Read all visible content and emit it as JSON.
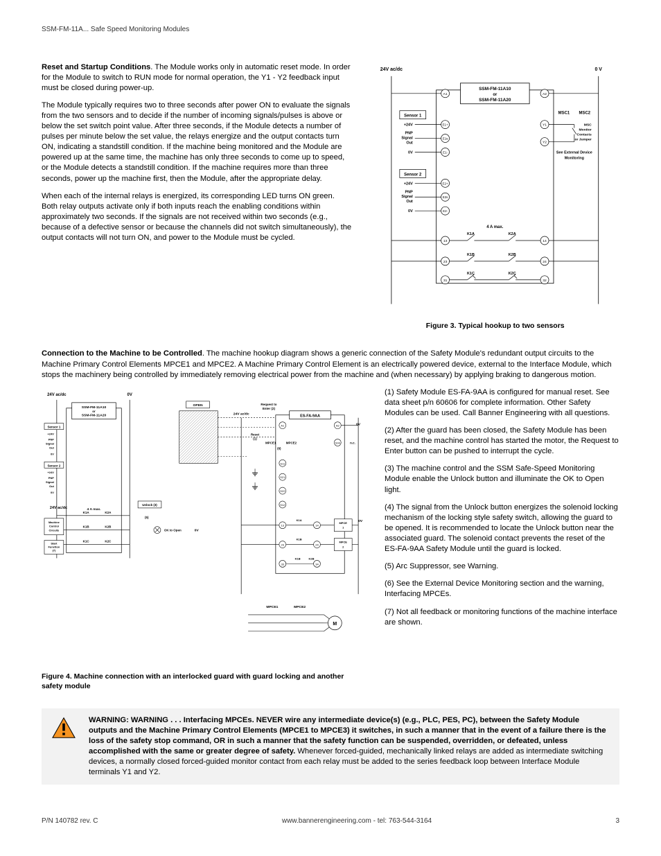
{
  "header": {
    "title": "SSM-FM-11A... Safe Speed Monitoring Modules"
  },
  "p1": {
    "lead": "Reset and Startup Conditions",
    "body": ". The Module works only in automatic reset mode. In order for the Module to switch to RUN mode for normal operation, the Y1 - Y2 feedback input must be closed during power-up."
  },
  "p2": "The Module typically requires two to three seconds after power ON to evaluate the signals from the two sensors and to decide if the number of incoming signals/pulses is above or below the set switch point value. After three seconds, if the Module detects a number of pulses per minute below the set value, the relays energize and the output contacts turn ON, indicating a standstill condition. If the machine being monitored and the Module are powered up at the same time, the machine has only three seconds to come up to speed, or the Module detects a standstill condition. If the machine requires more than three seconds, power up the machine first, then the Module, after the appropriate delay.",
  "p3": "When each of the internal relays is energized, its corresponding LED turns ON green. Both relay outputs activate only if both inputs reach the enabling conditions within approximately two seconds. If the signals are not received within two seconds (e.g., because of a defective sensor or because the channels did not switch simultaneously), the output contacts will not turn ON, and power to the Module must be cycled.",
  "fig3": {
    "caption": "Figure 3. Typical hookup to two sensors",
    "labels": {
      "v24": "24V ac/dc",
      "v0": "0 V",
      "model_a": "SSM-FM-11A10",
      "or": "or",
      "model_b": "SSM-FM-11A20",
      "s1": "Sensor 1",
      "s2": "Sensor 2",
      "p24": "+24V",
      "pnp": "PNP",
      "sig": "Signal",
      "out": "Out",
      "ov": "0V",
      "msc1": "MSC1",
      "msc2": "MSC2",
      "msc_note1": "MSC",
      "msc_note2": "Monitor",
      "msc_note3": "Contacts",
      "msc_note4": "or Jumper",
      "ext1": "See External Device",
      "ext2": "Monitoring",
      "amax": "4 A max.",
      "k1a": "K1A",
      "k2a": "K2A",
      "k1b": "K1B",
      "k2b": "K2B",
      "k1c": "K1C",
      "k2c": "K2C",
      "a1": "A1",
      "a2": "A2",
      "e1p": "E1+",
      "e1s": "E1s",
      "e1m": "E1-",
      "e2p": "E2+",
      "e2s": "E2s",
      "e2m": "E2-",
      "y1": "Y1",
      "y2": "Y2",
      "t13": "13",
      "t14": "14",
      "t23": "23",
      "t24": "24",
      "t31": "31",
      "t32": "32"
    }
  },
  "p4": {
    "lead": "Connection to the Machine to be Controlled",
    "body": ". The machine hookup diagram shows a generic connection of the Safety Module's redundant output circuits to the Machine Primary Control Elements MPCE1 and MPCE2. A Machine Primary Control Element is an electrically powered device, external to the Interface Module, which stops the machinery being controlled by immediately removing electrical power from the machine and (when necessary) by applying braking to dangerous motion."
  },
  "fig4": {
    "caption": "Figure 4. Machine connection with an interlocked guard with guard locking and another safety module",
    "labels": {
      "v24": "24V ac/dc",
      "v0": "0V",
      "open": "OPEN",
      "model_a": "SSM-FM-11A10",
      "or": "or",
      "model_b": "SSM-FM-11A20",
      "s1": "Sensor 1",
      "s2": "Sensor 2",
      "p24": "+24V",
      "pnp": "PNP",
      "sig": "Signal",
      "out": "Out",
      "ov": "0V",
      "req1": "Request to",
      "req2": "Enter (2)",
      "esfa": "ES-FA-9AA",
      "reset": "Reset",
      "reset_n": "(1)",
      "mpce1": "MPCE1",
      "mpce2": "MPCE2",
      "six": "(6)",
      "nc": "n.c.",
      "unlock": "Unlock (3)",
      "amax": "4 A max.",
      "five": "(5)",
      "mcc1": "Machine",
      "mcc2": "Control",
      "mcc3": "Circuits",
      "ok": "OK to Open",
      "start1": "Start",
      "start2": "Function",
      "start3": "(7)",
      "mpce_1": "MPCE",
      "one": "1",
      "two": "2",
      "m": "M",
      "k1a": "K1A",
      "k2a": "K2A",
      "k1b": "K1B",
      "k2b": "K2B",
      "k1c": "K1C",
      "k2c": "K2C",
      "a1": "A1",
      "a2": "A2",
      "s11": "S11",
      "e1": "E1",
      "s21": "S21",
      "s22": "S22",
      "s12": "S12",
      "s31": "S31",
      "s32": "S32",
      "s33": "S33",
      "s34": "S34",
      "t13": "13",
      "t14": "14",
      "t23": "23",
      "t24": "24",
      "t33": "33",
      "t34": "34"
    }
  },
  "notes": {
    "n1": "(1) Safety Module ES-FA-9AA is configured for manual reset. See data sheet p/n 60606 for complete information. Other Safety Modules can be used. Call Banner Engineering with all questions.",
    "n2": "(2) After the guard has been closed, the Safety Module has been reset, and the machine control has started the motor, the Request to Enter button can be pushed to interrupt the cycle.",
    "n3": "(3) The machine control and the SSM Safe-Speed Monitoring Module enable the Unlock button and illuminate the OK to Open light.",
    "n4": "(4) The signal from the Unlock button energizes the solenoid locking mechanism of the locking style safety switch, allowing the guard to be opened. It is recommended to locate the Unlock button near the associated guard. The solenoid contact prevents the reset of the ES-FA-9AA Safety Module until the guard is locked.",
    "n5": "(5) Arc Suppressor, see Warning.",
    "n6": "(6) See the External Device Monitoring section and the warning, Interfacing MPCEs.",
    "n7": "(7) Not all feedback or monitoring functions of the machine interface are shown."
  },
  "warning": {
    "lead": "WARNING: WARNING . . . Interfacing MPCEs. NEVER wire any intermediate device(s) (e.g., PLC, PES, PC), between the Safety Module outputs and the Machine Primary Control Elements (MPCE1 to MPCE3) it switches, in such a manner that in the event of a failure there is the loss of the safety stop command, OR in such a manner that the safety function can be suspended, overridden, or defeated, unless accomplished with the same or greater degree of safety.",
    "tail": " Whenever forced-guided, mechanically linked relays are added as intermediate switching devices, a normally closed forced-guided monitor contact from each relay must be added to the series feedback loop between Interface Module terminals Y1 and Y2."
  },
  "footer": {
    "left": "P/N 140782 rev. C",
    "center": "www.bannerengineering.com - tel: 763-544-3164",
    "right": "3"
  }
}
